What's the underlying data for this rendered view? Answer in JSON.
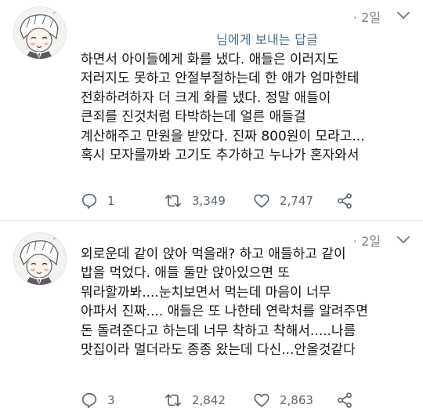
{
  "colors": {
    "text": "#14171a",
    "muted": "#7a8187",
    "reply_link": "#4c6f88",
    "icon": "#5b6670",
    "divider": "#d6d9dc"
  },
  "tweets": [
    {
      "time": "· 2일",
      "reply_to": "님에게 보내는 답글",
      "lines": [
        "하면서 아이들에게 화를 냈다. 애들은 이러지도",
        "저러지도 못하고 안절부절하는데 한 애가 엄마한테",
        "전화하려하자 더 크게 화를 냈다. 정말 애들이",
        "큰죄를 진것처럼 타박하는데 얼른 애들걸",
        "계산해주고 만원을 받았다. 진짜 800원이 모라고...",
        "혹시 모자를까봐 고기도 추가하고 누나가 혼자와서"
      ],
      "replies": "1",
      "retweets": "3,349",
      "likes": "2,747",
      "icons": [
        "reply-icon",
        "retweet-icon",
        "heart-icon",
        "share-icon",
        "caret-down-icon"
      ]
    },
    {
      "time": "· 2일",
      "lines": [
        "외로운데 같이 앉아 먹을래? 하고 애들하고 같이",
        "밥을 먹었다. 애들 둘만 앉아있으면 또",
        "뭐라할까봐....눈치보면서 먹는데 마음이 너무",
        "아파서 진짜.... 애들은 또 나한테 연락처를 알려주면",
        "돈 돌려준다고 하는데 너무 착하고 착해서.....나름",
        "맛집이라 멀더라도 종종 왔는데 다신...안올것같다"
      ],
      "replies": "3",
      "retweets": "2,842",
      "likes": "2,863",
      "icons": [
        "reply-icon",
        "retweet-icon",
        "heart-icon",
        "share-icon",
        "caret-down-icon"
      ]
    }
  ]
}
